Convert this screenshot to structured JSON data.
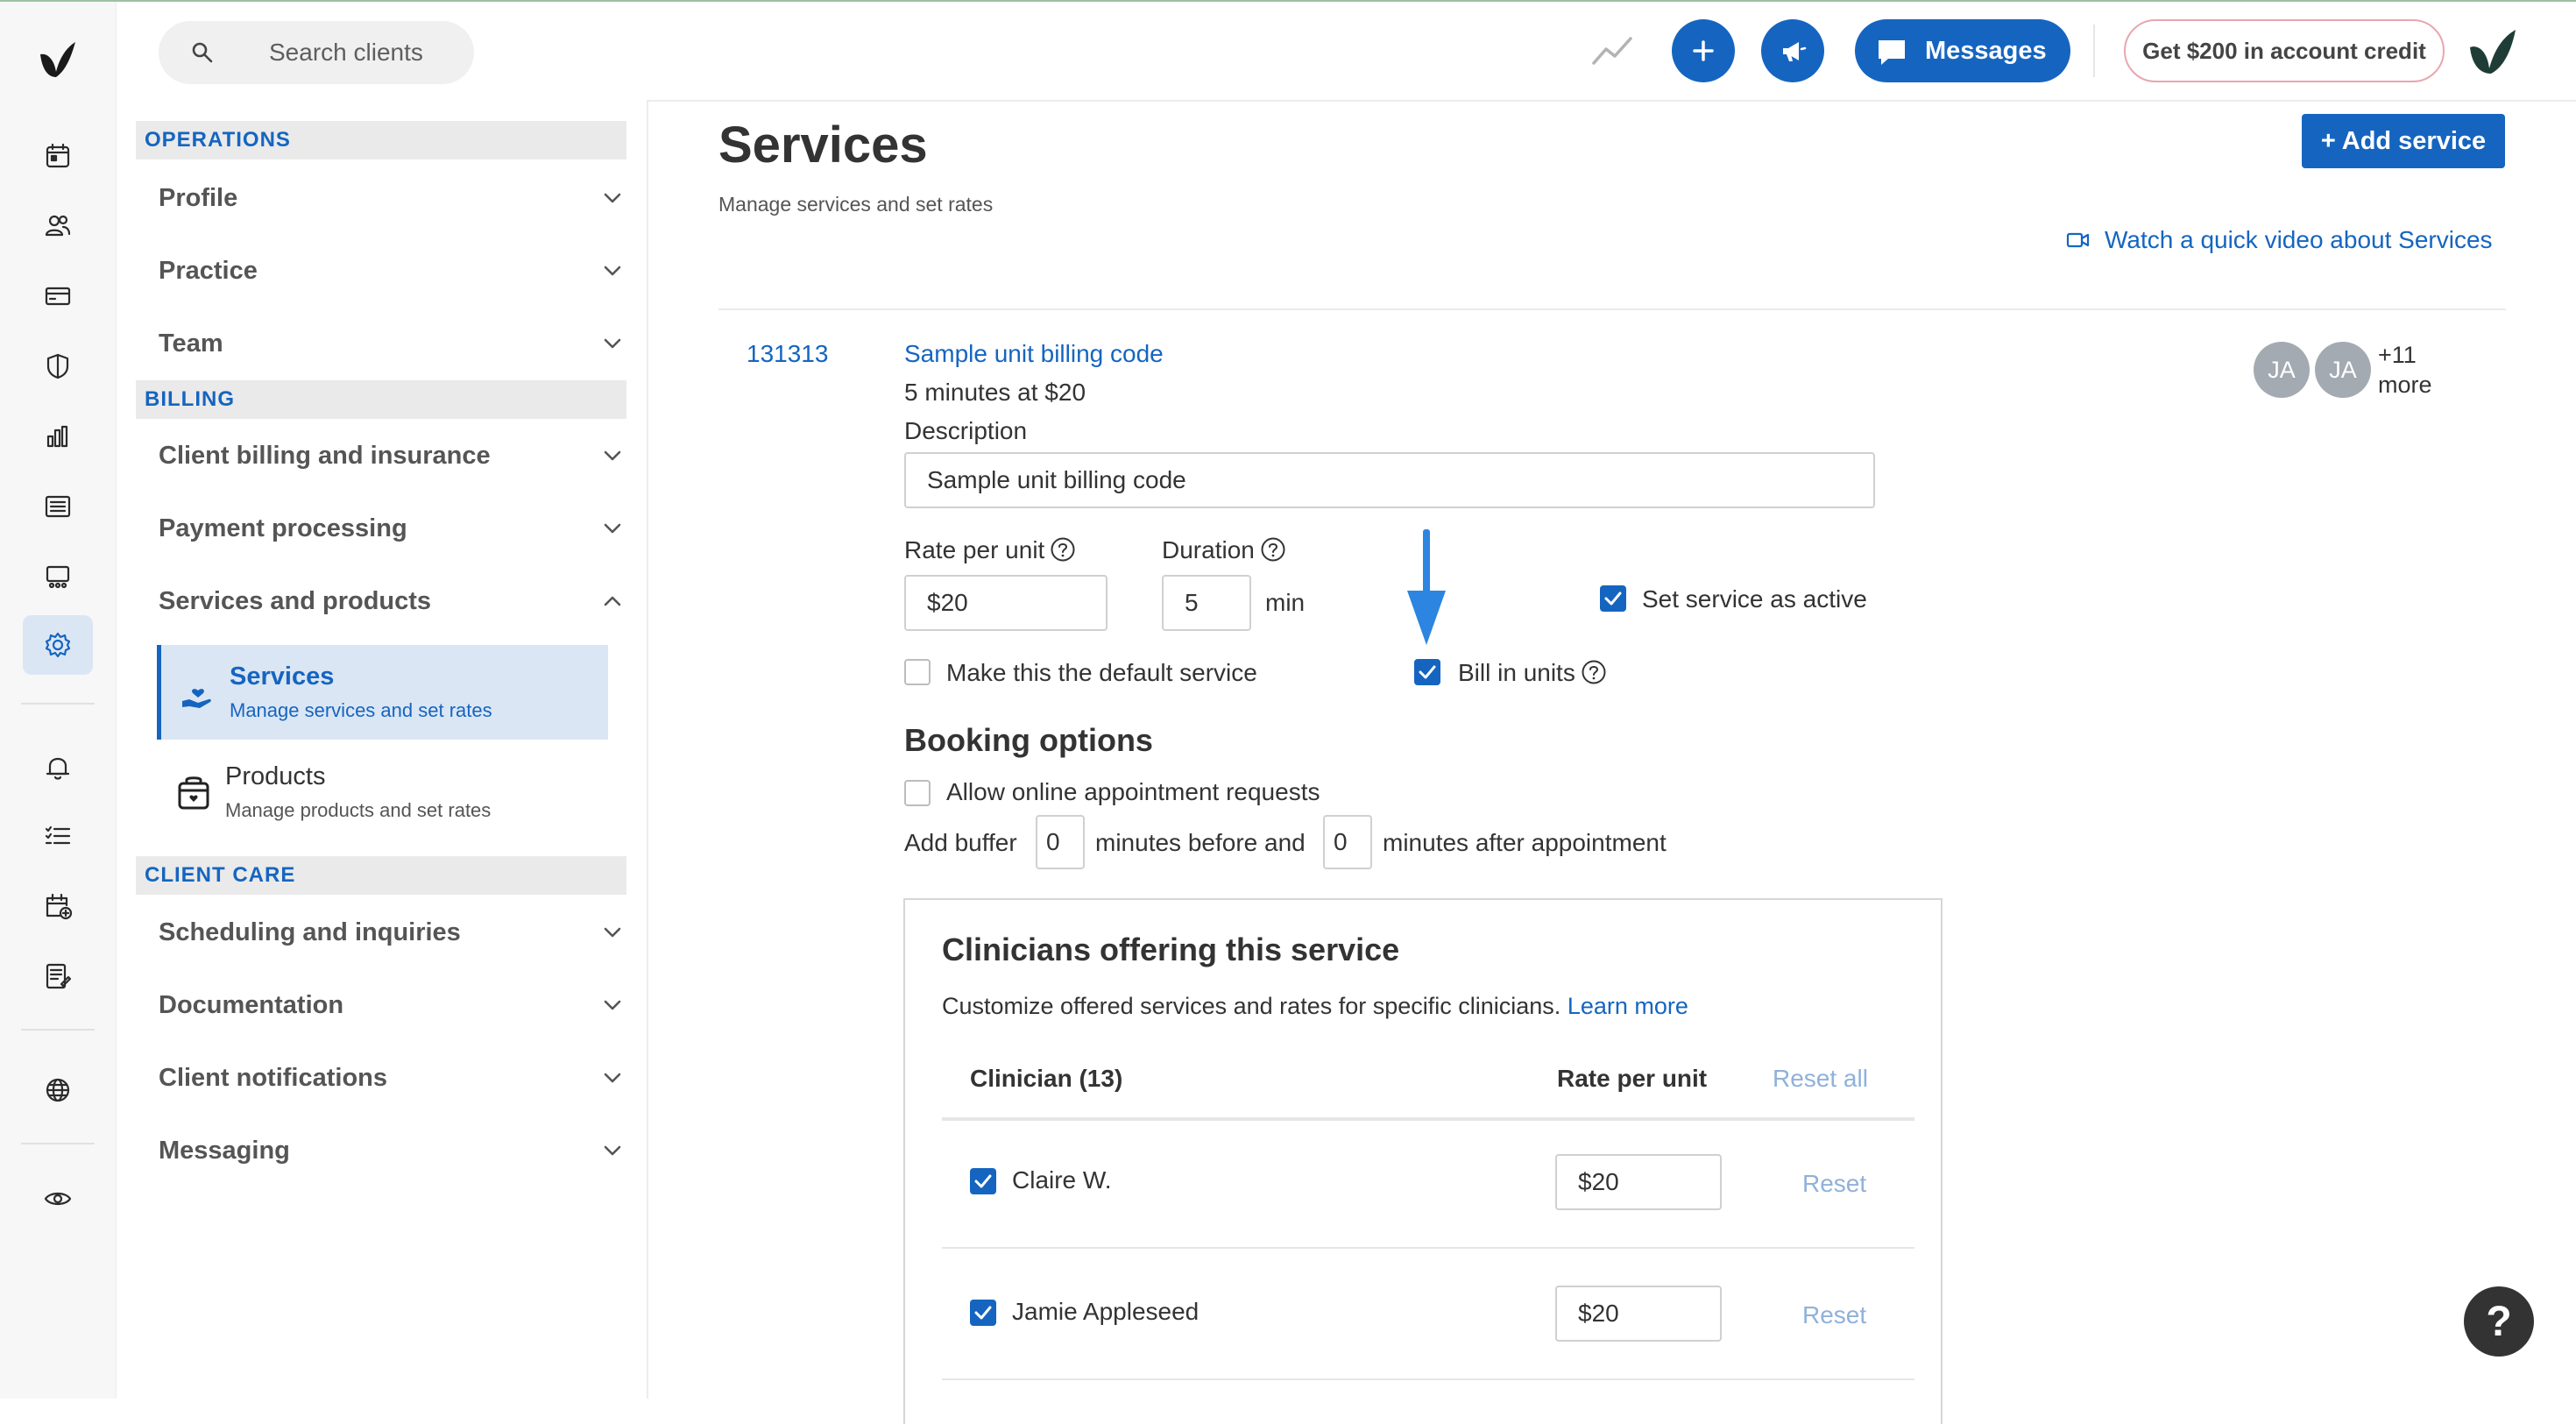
{
  "topbar": {
    "search_placeholder": "Search clients",
    "messages_label": "Messages",
    "credit_label": "Get $200 in account credit"
  },
  "nav": {
    "sections": {
      "operations": "OPERATIONS",
      "billing": "BILLING",
      "client_care": "CLIENT CARE"
    },
    "items": {
      "profile": "Profile",
      "practice": "Practice",
      "team": "Team",
      "client_billing": "Client billing and insurance",
      "payment_processing": "Payment processing",
      "services_products": "Services and products",
      "scheduling": "Scheduling and inquiries",
      "documentation": "Documentation",
      "client_notifications": "Client notifications",
      "messaging": "Messaging"
    },
    "sub_items": {
      "services": {
        "title": "Services",
        "desc": "Manage services and set rates"
      },
      "products": {
        "title": "Products",
        "desc": "Manage products and set rates"
      }
    }
  },
  "main": {
    "title": "Services",
    "subtitle": "Manage services and set rates",
    "add_button": "+ Add service",
    "video_link": "Watch a quick video about Services",
    "service": {
      "code": "131313",
      "name": "Sample unit billing code",
      "meta": "5 minutes at $20",
      "description_label": "Description",
      "description_value": "Sample unit billing code",
      "rate_label": "Rate per unit",
      "rate_value": "$20",
      "duration_label": "Duration",
      "duration_value": "5",
      "duration_unit": "min",
      "set_active_label": "Set service as active",
      "set_active_checked": true,
      "default_label": "Make this the default service",
      "default_checked": false,
      "bill_units_label": "Bill in units",
      "bill_units_checked": true,
      "avatars": [
        "JA",
        "JA"
      ],
      "more_count": "+11",
      "more_label": "more"
    },
    "booking": {
      "heading": "Booking options",
      "online_label": "Allow online appointment requests",
      "online_checked": false,
      "buffer_prefix": "Add buffer",
      "buffer_before": "0",
      "buffer_middle": "minutes before and",
      "buffer_after": "0",
      "buffer_suffix": "minutes after appointment"
    },
    "clinicians": {
      "heading": "Clinicians offering this service",
      "subtext": "Customize offered services and rates for specific clinicians.",
      "learn_more": "Learn more",
      "col_clinician": "Clinician (13)",
      "col_rate": "Rate per unit",
      "reset_all": "Reset all",
      "rows": [
        {
          "name": "Claire W.",
          "rate": "$20",
          "checked": true,
          "reset": "Reset"
        },
        {
          "name": "Jamie Appleseed",
          "rate": "$20",
          "checked": true,
          "reset": "Reset"
        }
      ]
    }
  },
  "help_fab": "?",
  "colors": {
    "accent": "#1565c0",
    "active_bg": "#dbe6f4",
    "muted_link": "#8fb1db"
  },
  "icons": {
    "rail": [
      "calendar-icon",
      "clients-icon",
      "billing-card-icon",
      "shield-icon",
      "analytics-icon",
      "list-icon",
      "marketplace-icon",
      "settings-gear-icon",
      "bell-icon",
      "tasks-icon",
      "calendar-add-icon",
      "notes-icon",
      "globe-icon",
      "eye-icon"
    ]
  }
}
